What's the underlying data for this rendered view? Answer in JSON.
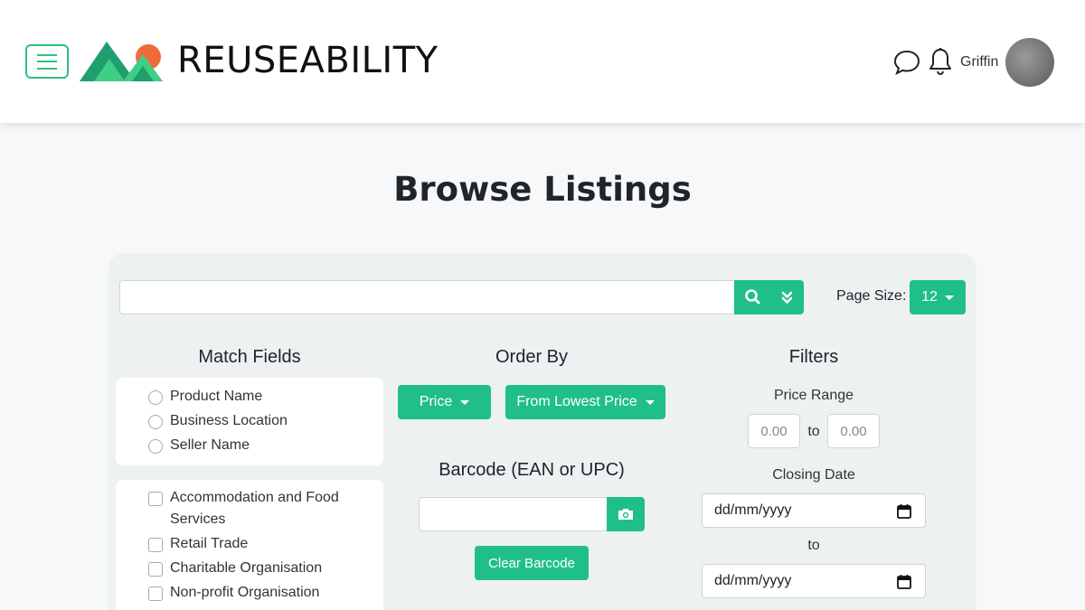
{
  "header": {
    "brand": "REUSEABILITY",
    "user_name": "Griffin",
    "colors": {
      "accent": "#20bf8a",
      "hamburger": "#2ec27e",
      "sun": "#f06a3c",
      "mountain_dark": "#1f9e6e",
      "mountain_light": "#3fcf84"
    }
  },
  "page": {
    "title": "Browse Listings"
  },
  "search": {
    "value": "",
    "search_icon": "search-icon",
    "expand_icon": "double-chevron-down-icon",
    "page_size_label": "Page Size:",
    "page_size_value": "12"
  },
  "match_fields": {
    "title": "Match Fields",
    "options": [
      "Product Name",
      "Business Location",
      "Seller Name"
    ],
    "business_types": [
      "Accommodation and Food Services",
      "Retail Trade",
      "Charitable Organisation",
      "Non-profit Organisation"
    ]
  },
  "order_by": {
    "title": "Order By",
    "field": "Price",
    "direction": "From Lowest Price"
  },
  "barcode": {
    "title": "Barcode (EAN or UPC)",
    "value": "",
    "camera_icon": "camera-icon",
    "clear_label": "Clear Barcode"
  },
  "filters": {
    "title": "Filters",
    "price_range_label": "Price Range",
    "price_min_placeholder": "0.00",
    "price_to": "to",
    "price_max_placeholder": "0.00",
    "closing_date_label": "Closing Date",
    "date_from": "dd/mm/yyyy",
    "date_to_label": "to",
    "date_to": "dd/mm/yyyy"
  }
}
